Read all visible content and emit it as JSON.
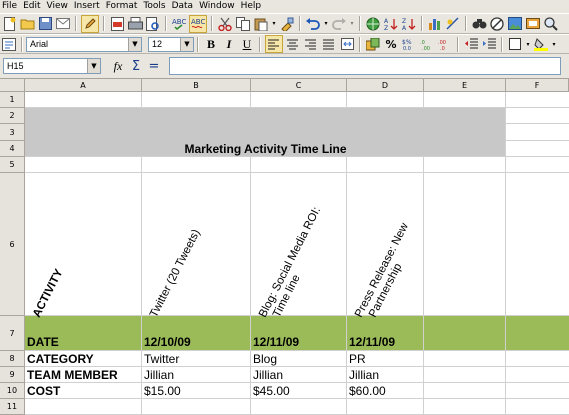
{
  "menu": [
    "File",
    "Edit",
    "View",
    "Insert",
    "Format",
    "Tools",
    "Data",
    "Window",
    "Help"
  ],
  "toolbar": {
    "font_name": "Arial",
    "font_size": "12",
    "bold": "B",
    "italic": "I",
    "underline": "U"
  },
  "formula": {
    "name_box": "H15",
    "fx": "fx",
    "sum": "Σ",
    "equals": "="
  },
  "columns": [
    "A",
    "B",
    "C",
    "D",
    "E",
    "F"
  ],
  "rows": [
    "1",
    "2",
    "3",
    "4",
    "5",
    "6",
    "7",
    "8",
    "9",
    "10",
    "11"
  ],
  "sheet": {
    "title": "Marketing Activity Time Line",
    "header_activity": "ACTIVITY",
    "twitter_header": "Twitter (20 Tweets)",
    "blog_header_1": "Blog: Social Media ROI:",
    "blog_header_2": "Time line",
    "pr_header_1": "Press Release: New",
    "pr_header_2": "Partnership",
    "date_label": "DATE",
    "date_b": "12/10/09",
    "date_c": "12/11/09",
    "date_d": "12/11/09",
    "category_label": "CATEGORY",
    "category_b": "Twitter",
    "category_c": "Blog",
    "category_d": "PR",
    "team_label": "TEAM MEMBER",
    "team_b": "Jillian",
    "team_c": "Jillian",
    "team_d": "Jillian",
    "cost_label": "COST",
    "cost_b": "$15.00",
    "cost_c": "$45.00",
    "cost_d": "$60.00"
  },
  "colors": {
    "title_band": "#c8c8c8",
    "date_band": "#9bbb59"
  }
}
